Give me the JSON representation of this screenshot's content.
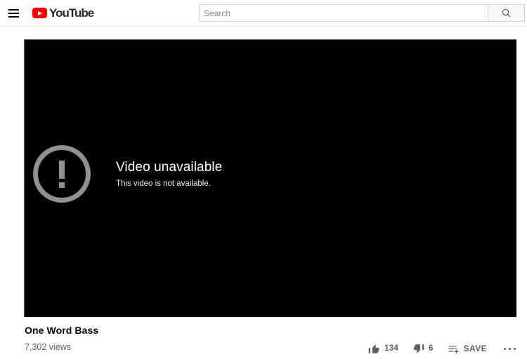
{
  "header": {
    "menu_icon": "hamburger-menu-icon",
    "logo_text": "YouTube",
    "logo_icon": "youtube-play-icon",
    "brand_color": "#ff0000",
    "search": {
      "placeholder": "Search",
      "value": "",
      "button_icon": "search-icon"
    }
  },
  "player": {
    "state_icon": "alert-exclamation-circle-icon",
    "state_title": "Video unavailable",
    "state_subtitle": "This video is not available.",
    "background_color": "#000000",
    "icon_color": "#909090"
  },
  "video": {
    "title": "One Word Bass",
    "views": "7,302 views"
  },
  "actions": {
    "like": {
      "icon": "thumbs-up-icon",
      "count": "134"
    },
    "dislike": {
      "icon": "thumbs-down-icon",
      "count": "6"
    },
    "save": {
      "icon": "save-to-playlist-icon",
      "label": "SAVE"
    },
    "more": {
      "icon": "more-horizontal-icon"
    }
  }
}
